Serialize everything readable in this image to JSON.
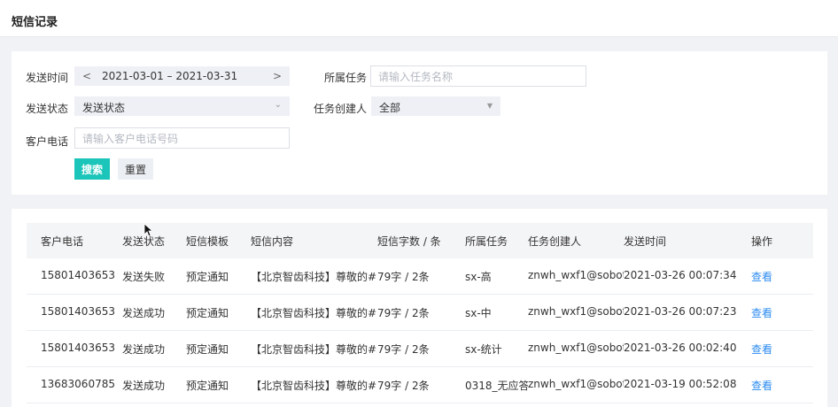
{
  "header": {
    "title": "短信记录"
  },
  "filters": {
    "send_time_label": "发送时间",
    "date_range": "2021-03-01 – 2021-03-31",
    "date_prev": "<",
    "date_next": ">",
    "task_label": "所属任务",
    "task_placeholder": "请输入任务名称",
    "status_label": "发送状态",
    "status_value": "发送状态",
    "creator_label": "任务创建人",
    "creator_value": "全部",
    "phone_label": "客户电话",
    "phone_placeholder": "请输入客户电话号码",
    "search_button": "搜索",
    "reset_button": "重置"
  },
  "table": {
    "columns": [
      "客户电话",
      "发送状态",
      "短信模板",
      "短信内容",
      "短信字数 / 条",
      "所属任务",
      "任务创建人",
      "发送时间",
      "操作"
    ],
    "rows": [
      {
        "phone": "15801403653",
        "status": "发送失败",
        "template": "预定通知",
        "content": "【北京智齿科技】尊敬的#...",
        "count": "79字 / 2条",
        "task": "sx-高",
        "creator": "znwh_wxf1@sobot...",
        "time": "2021-03-26 00:07:34",
        "action": "查看"
      },
      {
        "phone": "15801403653",
        "status": "发送成功",
        "template": "预定通知",
        "content": "【北京智齿科技】尊敬的#...",
        "count": "79字 / 2条",
        "task": "sx-中",
        "creator": "znwh_wxf1@sobot...",
        "time": "2021-03-26 00:07:23",
        "action": "查看"
      },
      {
        "phone": "15801403653",
        "status": "发送成功",
        "template": "预定通知",
        "content": "【北京智齿科技】尊敬的#...",
        "count": "79字 / 2条",
        "task": "sx-统计",
        "creator": "znwh_wxf1@sobot...",
        "time": "2021-03-26 00:02:40",
        "action": "查看"
      },
      {
        "phone": "13683060785",
        "status": "发送成功",
        "template": "预定通知",
        "content": "【北京智齿科技】尊敬的#...",
        "count": "79字 / 2条",
        "task": "0318_无应答",
        "creator": "znwh_wxf1@sobot...",
        "time": "2021-03-19 00:52:08",
        "action": "查看"
      }
    ]
  },
  "colors": {
    "accent": "#1bc5b9",
    "link": "#2d8cf0"
  }
}
